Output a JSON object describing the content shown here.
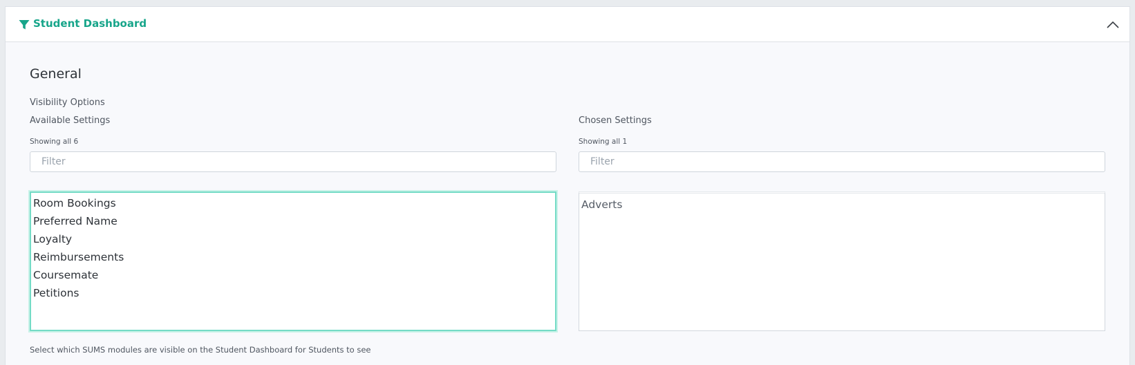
{
  "card": {
    "title": "Student Dashboard",
    "accent_color": "#17a58a",
    "icons": {
      "title": "filter-icon",
      "collapse": "chevron-up-icon"
    }
  },
  "section": {
    "heading": "General",
    "group_label": "Visibility Options",
    "help_text": "Select which SUMS modules are visible on the Student Dashboard for Students to see"
  },
  "available": {
    "label": "Available Settings",
    "count_text": "Showing all 6",
    "filter_placeholder": "Filter",
    "items": [
      "Room Bookings",
      "Preferred Name",
      "Loyalty",
      "Reimbursements",
      "Coursemate",
      "Petitions"
    ]
  },
  "chosen": {
    "label": "Chosen Settings",
    "count_text": "Showing all 1",
    "filter_placeholder": "Filter",
    "items": [
      "Adverts"
    ]
  }
}
